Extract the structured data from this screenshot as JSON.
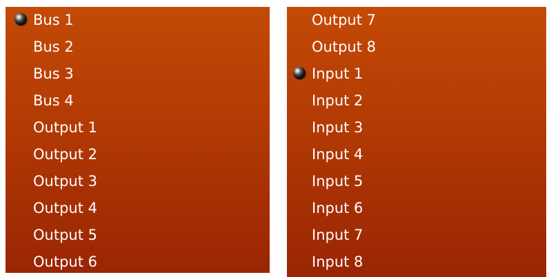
{
  "left_menu": {
    "items": [
      {
        "label": "Bus 1",
        "selected": true
      },
      {
        "label": "Bus 2",
        "selected": false
      },
      {
        "label": "Bus 3",
        "selected": false
      },
      {
        "label": "Bus 4",
        "selected": false
      },
      {
        "label": "Output 1",
        "selected": false
      },
      {
        "label": "Output 2",
        "selected": false
      },
      {
        "label": "Output 3",
        "selected": false
      },
      {
        "label": "Output 4",
        "selected": false
      },
      {
        "label": "Output 5",
        "selected": false
      },
      {
        "label": "Output 6",
        "selected": false
      }
    ]
  },
  "right_menu": {
    "items": [
      {
        "label": "Output 7",
        "selected": false
      },
      {
        "label": "Output 8",
        "selected": false
      },
      {
        "label": "Input 1",
        "selected": true
      },
      {
        "label": "Input 2",
        "selected": false
      },
      {
        "label": "Input 3",
        "selected": false
      },
      {
        "label": "Input 4",
        "selected": false
      },
      {
        "label": "Input 5",
        "selected": false
      },
      {
        "label": "Input 6",
        "selected": false
      },
      {
        "label": "Input 7",
        "selected": false
      },
      {
        "label": "Input 8",
        "selected": false
      }
    ]
  },
  "colors": {
    "menu_top": "#c44a06",
    "menu_bottom": "#9a2503",
    "text": "#ffffff"
  },
  "icons": {
    "selected_marker": "radio-dot-icon"
  }
}
